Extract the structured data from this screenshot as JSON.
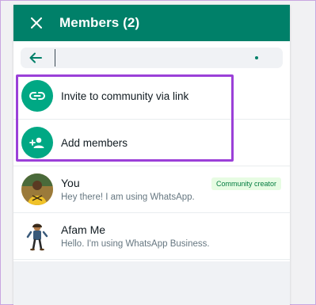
{
  "header": {
    "title": "Members (2)",
    "close_icon": "close-icon",
    "bg_color": "#008069"
  },
  "search": {
    "back_icon": "arrow-left-icon",
    "value": "",
    "placeholder": ""
  },
  "actions": [
    {
      "label": "Invite to community via link",
      "icon": "link-icon"
    },
    {
      "label": "Add members",
      "icon": "add-person-icon"
    }
  ],
  "members": [
    {
      "name": "You",
      "status": "Hey there! I am using WhatsApp.",
      "badge": "Community creator",
      "avatar": "avatar-photo"
    },
    {
      "name": "Afam Me",
      "status": "Hello. I'm using WhatsApp Business.",
      "avatar": "avatar-illustration"
    }
  ],
  "colors": {
    "accent": "#00a884",
    "highlight": "#9b40d8",
    "badge_bg": "#e7fce3",
    "badge_text": "#027b3f"
  }
}
